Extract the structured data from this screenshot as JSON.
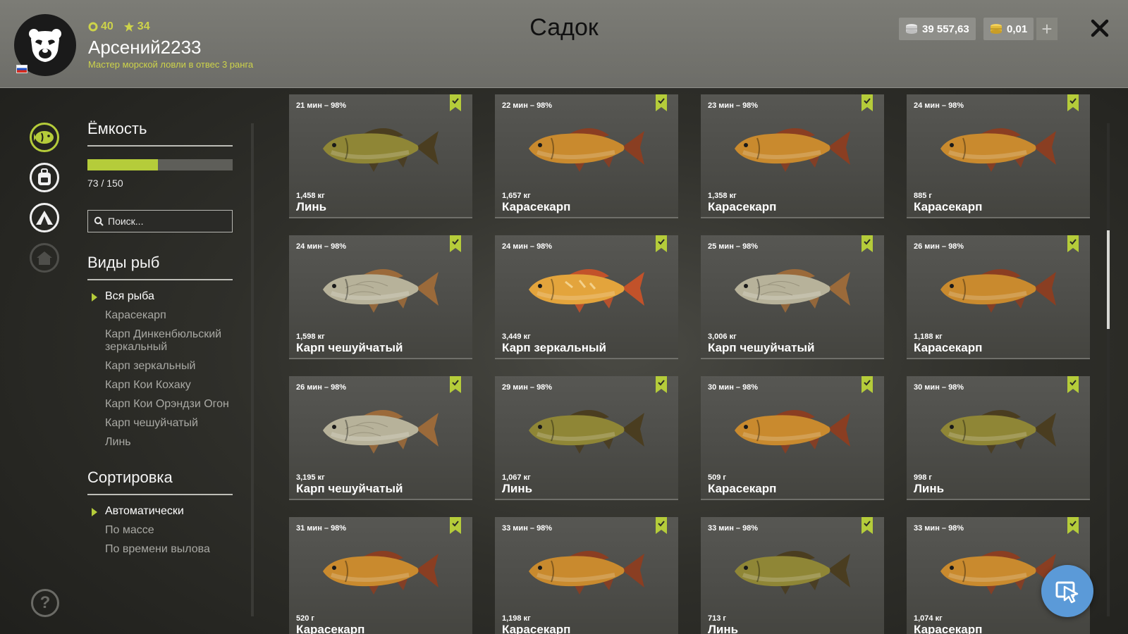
{
  "header": {
    "title": "Садок",
    "username": "Арсений2233",
    "rank": "Мастер морской ловли в отвес 3 ранга",
    "level": "40",
    "stars": "34",
    "silver": "39 557,63",
    "gold": "0,01",
    "plus_label": "+"
  },
  "capacity": {
    "heading": "Ёмкость",
    "text": "73 / 150",
    "fill_fraction": 0.487
  },
  "search": {
    "placeholder": "Поиск..."
  },
  "species": {
    "heading": "Виды рыб",
    "items": [
      "Вся рыба",
      "Карасекарп",
      "Карп Динкенбюльский зеркальный",
      "Карп зеркальный",
      "Карп Кои Кохаку",
      "Карп Кои Орэндзи Огон",
      "Карп чешуйчатый",
      "Линь"
    ],
    "active_index": 0
  },
  "sorting": {
    "heading": "Сортировка",
    "items": [
      "Автоматически",
      "По массе",
      "По времени вылова"
    ],
    "active_index": 0
  },
  "help_label": "?",
  "fish": [
    {
      "time": "21 мин – 98%",
      "weight": "1,458 кг",
      "name": "Линь",
      "kind": "tench"
    },
    {
      "time": "22 мин – 98%",
      "weight": "1,657 кг",
      "name": "Карасекарп",
      "kind": "crucian"
    },
    {
      "time": "23 мин – 98%",
      "weight": "1,358 кг",
      "name": "Карасекарп",
      "kind": "crucian"
    },
    {
      "time": "24 мин – 98%",
      "weight": "885 г",
      "name": "Карасекарп",
      "kind": "crucian"
    },
    {
      "time": "24 мин – 98%",
      "weight": "1,598 кг",
      "name": "Карп чешуйчатый",
      "kind": "common"
    },
    {
      "time": "24 мин – 98%",
      "weight": "3,449 кг",
      "name": "Карп зеркальный",
      "kind": "mirror"
    },
    {
      "time": "25 мин – 98%",
      "weight": "3,006 кг",
      "name": "Карп чешуйчатый",
      "kind": "common"
    },
    {
      "time": "26 мин – 98%",
      "weight": "1,188 кг",
      "name": "Карасекарп",
      "kind": "crucian"
    },
    {
      "time": "26 мин – 98%",
      "weight": "3,195 кг",
      "name": "Карп чешуйчатый",
      "kind": "common"
    },
    {
      "time": "29 мин – 98%",
      "weight": "1,067 кг",
      "name": "Линь",
      "kind": "tench"
    },
    {
      "time": "30 мин – 98%",
      "weight": "509 г",
      "name": "Карасекарп",
      "kind": "crucian"
    },
    {
      "time": "30 мин – 98%",
      "weight": "998 г",
      "name": "Линь",
      "kind": "tench"
    },
    {
      "time": "31 мин – 98%",
      "weight": "520 г",
      "name": "Карасекарп",
      "kind": "crucian"
    },
    {
      "time": "33 мин – 98%",
      "weight": "1,198 кг",
      "name": "Карасекарп",
      "kind": "crucian"
    },
    {
      "time": "33 мин – 98%",
      "weight": "713 г",
      "name": "Линь",
      "kind": "tench"
    },
    {
      "time": "33 мин – 98%",
      "weight": "1,074 кг",
      "name": "Карасекарп",
      "kind": "crucian"
    }
  ],
  "fish_colors": {
    "tench": {
      "body": "#8f8636",
      "fin": "#4a3d20"
    },
    "crucian": {
      "body": "#c98a2e",
      "fin": "#8a3e22"
    },
    "common": {
      "body": "#b7b29a",
      "fin": "#9b6a3a"
    },
    "mirror": {
      "body": "#e3a43c",
      "fin": "#c2522a"
    }
  },
  "icons": {
    "nav": [
      "fish-nav-icon",
      "backpack-nav-icon",
      "camp-nav-icon",
      "home-nav-icon"
    ],
    "bookmark": "bookmark-icon",
    "fab": "cursor-icon"
  },
  "accent_color": "#b5cc3a"
}
